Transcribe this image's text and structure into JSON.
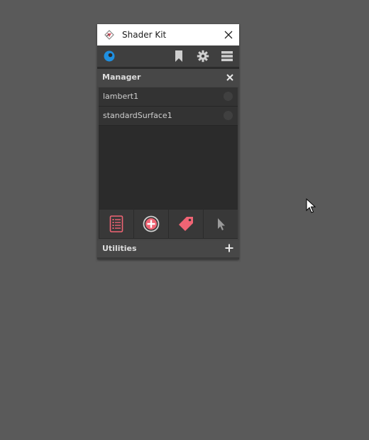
{
  "window": {
    "title": "Shader Kit"
  },
  "toolbar": {
    "icons": [
      "status-indicator-icon",
      "bookmark-icon",
      "gear-icon",
      "menu-icon"
    ]
  },
  "manager": {
    "title": "Manager",
    "items": [
      {
        "label": "lambert1"
      },
      {
        "label": "standardSurface1"
      }
    ],
    "actions": [
      "list-icon",
      "add-circle-icon",
      "tag-icon",
      "pointer-icon"
    ]
  },
  "utilities": {
    "title": "Utilities"
  },
  "colors": {
    "accent_blue": "#1f8fe0",
    "accent_pink": "#f06474",
    "panel_bg": "#444444",
    "list_bg": "#2b2b2b"
  }
}
